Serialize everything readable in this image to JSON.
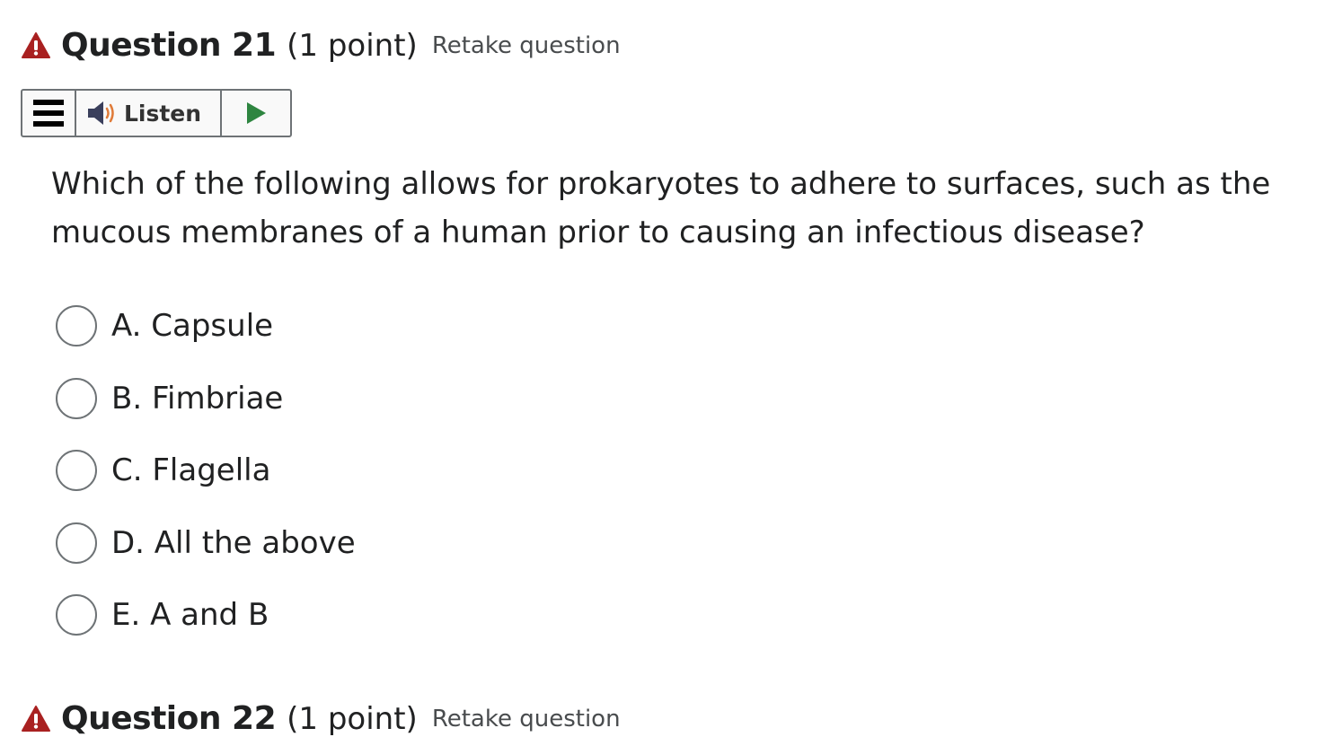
{
  "question": {
    "title": "Question 21",
    "points": "(1 point)",
    "retake": "Retake question",
    "text": "Which of the following allows for prokaryotes to adhere to surfaces, such as the mucous membranes of a human prior to causing an infectious disease?",
    "options": [
      {
        "label": "A. Capsule"
      },
      {
        "label": "B. Fimbriae"
      },
      {
        "label": "C. Flagella"
      },
      {
        "label": "D. All the above"
      },
      {
        "label": "E. A and B"
      }
    ]
  },
  "toolbar": {
    "listen_label": "Listen",
    "icons": [
      "menu-icon",
      "speaker-icon",
      "play-icon"
    ]
  },
  "next_question": {
    "title": "Question 22",
    "points": "(1 point)",
    "retake": "Retake question"
  },
  "colors": {
    "warning": "#a92121",
    "play": "#2e8540",
    "speaker_waves": "#e07b39",
    "border": "#6e7376"
  }
}
